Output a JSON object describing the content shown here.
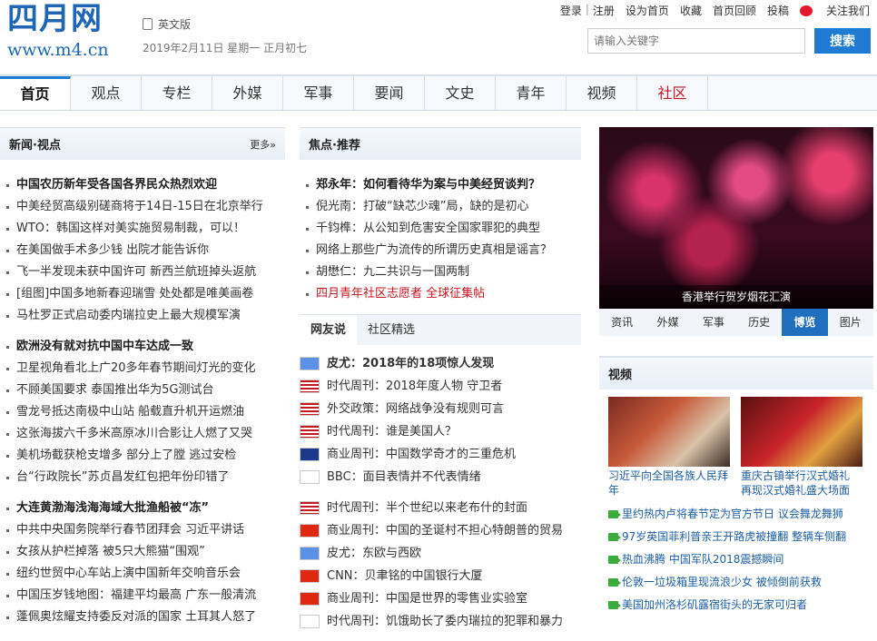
{
  "header": {
    "logo_cn": "四月网",
    "logo_url": "www.m4.cn",
    "english_version": "英文版",
    "date": "2019年2月11日 星期一 正月初七",
    "links": {
      "login": "登录",
      "sep": "|",
      "register": "注册",
      "set_home": "设为首页",
      "favorite": "收藏",
      "back_old": "首页回顾",
      "submit": "投稿",
      "follow": "关注我们"
    },
    "search_placeholder": "请输入关键字",
    "search_button": "搜索"
  },
  "nav": [
    "首页",
    "观点",
    "专栏",
    "外媒",
    "军事",
    "要闻",
    "文史",
    "青年",
    "视频",
    "社区"
  ],
  "news": {
    "title": "新闻·视点",
    "more": "更多»",
    "group1": [
      "中国农历新年受各国各界民众热烈欢迎",
      "中美经贸高级别磋商将于14日-15日在北京举行",
      "WTO：韩国这样对美实施贸易制裁，可以！",
      "在美国做手术多少钱 出院才能告诉你",
      "飞一半发现未获中国许可 新西兰航班掉头返航",
      "[组图]中国多地新春迎瑞雪 处处都是唯美画卷",
      "马杜罗正式启动委内瑞拉史上最大规模军演"
    ],
    "group2": [
      "欧洲没有就对抗中国中车达成一致",
      "卫星视角看北上广20多年春节期间灯光的变化",
      "不顾美国要求 泰国推出华为5G测试台",
      "雪龙号抵达南极中山站 船载直升机开运燃油",
      "这张海拔六千多米高原冰川合影让人燃了又哭",
      "美机场截获枪支增多 部分上了膛 逃过安检",
      "台“行政院长”苏贞昌发红包把年份印错了"
    ],
    "group3": [
      "大连黄渤海浅海海域大批渔船被“冻”",
      "中共中央国务院举行春节团拜会 习近平讲话",
      "女孩从护栏掉落 被5只大熊猫“围观”",
      "纽约世贸中心车站上演中国新年交响音乐会",
      "中国压岁钱地图：福建平均最高 广东一般清流",
      "蓬佩奥炫耀支持委反对派的国家 土耳其人怒了"
    ]
  },
  "focus": {
    "title": "焦点·推荐",
    "items": [
      "郑永年：如何看待华为案与中美经贸谈判？",
      "倪光南：打破“缺芯少魂”局，缺的是初心",
      "千钧榫：从公知到危害安全国家罪犯的典型",
      "网络上那些广为流传的所谓历史真相是谣言？",
      "胡懋仁：九二共识与一国两制",
      "四月青年社区志愿者 全球征集帖"
    ]
  },
  "netfriends": {
    "tab1": "网友说",
    "tab2": "社区精选",
    "group1": [
      "皮尤：2018年的18项惊人发现",
      "时代周刊：2018年度人物 守卫者",
      "外交政策：网络战争没有规则可言",
      "时代周刊：谁是美国人？",
      "商业周刊：中国数学奇才的三重危机",
      "BBC：面目表情并不代表情绪"
    ],
    "group2": [
      "时代周刊：半个世纪以来老布什的封面",
      "商业周刊：中国的圣诞村不担心特朗普的贸易",
      "皮尤：东欧与西欧",
      "CNN：贝聿铭的中国银行大厦",
      "商业周刊：中国是世界的零售业实验室",
      "时代周刊：饥饿助长了委内瑞拉的犯罪和暴力"
    ],
    "flags1": [
      "un",
      "us",
      "us",
      "us",
      "uk",
      "blank"
    ],
    "flags2": [
      "us",
      "cn",
      "un",
      "cn",
      "cn",
      "blank"
    ]
  },
  "photo": {
    "caption": "香港举行贺岁烟花汇演"
  },
  "photo_tabs": [
    "资讯",
    "外媒",
    "军事",
    "历史",
    "博览",
    "图片"
  ],
  "video": {
    "title": "视频",
    "thumb1": "习近平向全国各族人民拜年",
    "thumb2": "重庆古镇举行汉式婚礼 再现汉式婚礼盛大场面",
    "items": [
      "里约热内卢将春节定为官方节日 议会舞龙舞狮",
      "97岁英国菲利普亲王开路虎被撞翻 整辆车侧翻",
      "热血沸腾 中国军队2018震撼瞬间",
      "伦敦一垃圾箱里现流浪少女 被倾倒前获救",
      "美国加州洛杉矶露宿街头的无家可归者"
    ]
  }
}
